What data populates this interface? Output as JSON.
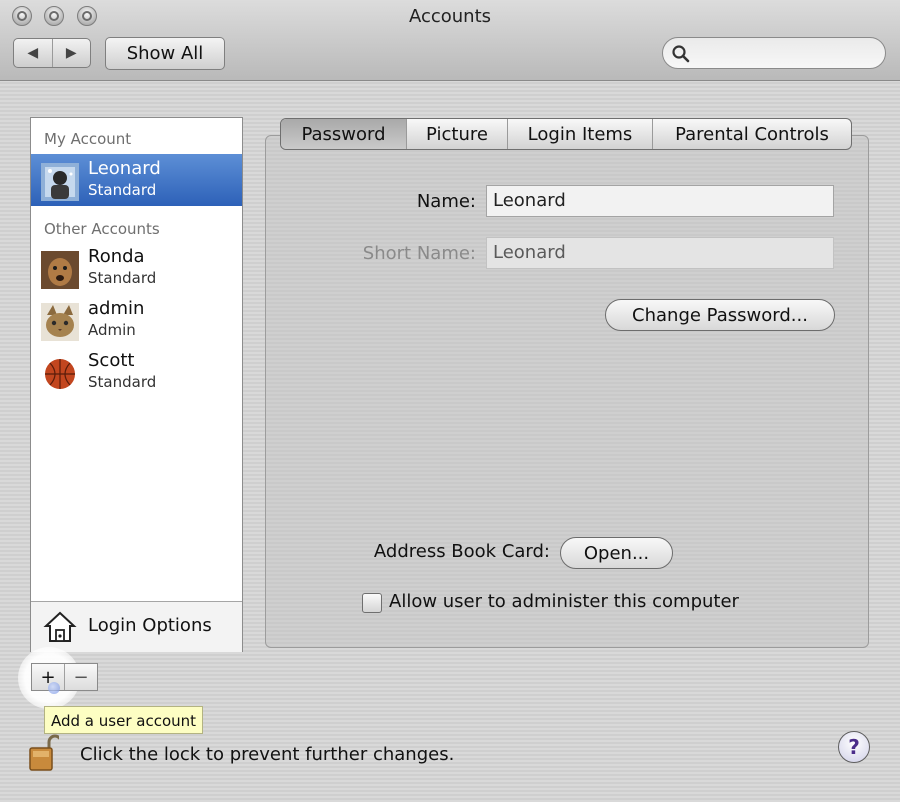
{
  "window": {
    "title": "Accounts"
  },
  "toolbar": {
    "back_glyph": "◀",
    "forward_glyph": "▶",
    "show_all": "Show All",
    "search_placeholder": ""
  },
  "sidebar": {
    "my_account_header": "My Account",
    "other_accounts_header": "Other Accounts",
    "my_account": {
      "name": "Leonard",
      "role": "Standard",
      "icon": "astronaut-avatar"
    },
    "other_accounts": [
      {
        "name": "Ronda",
        "role": "Standard",
        "icon": "dog-avatar"
      },
      {
        "name": "admin",
        "role": "Admin",
        "icon": "cat-avatar"
      },
      {
        "name": "Scott",
        "role": "Standard",
        "icon": "basketball-avatar"
      }
    ],
    "login_options": "Login Options",
    "add_glyph": "+",
    "remove_glyph": "−"
  },
  "tooltip": "Add a user account",
  "tabs": [
    {
      "label": "Password",
      "active": true
    },
    {
      "label": "Picture",
      "active": false
    },
    {
      "label": "Login Items",
      "active": false
    },
    {
      "label": "Parental Controls",
      "active": false
    }
  ],
  "password_tab": {
    "name_label": "Name:",
    "name_value": "Leonard",
    "short_name_label": "Short Name:",
    "short_name_value": "Leonard",
    "change_password": "Change Password...",
    "address_book_label": "Address Book Card:",
    "open_button": "Open...",
    "admin_checkbox_label": "Allow user to administer this computer",
    "admin_checked": false
  },
  "footer": {
    "lock_text": "Click the lock to prevent further changes.",
    "help_glyph": "?"
  },
  "colors": {
    "selection_top": "#5d8fd6",
    "selection_bottom": "#2d61b8",
    "tooltip_bg": "#fdfec3"
  }
}
